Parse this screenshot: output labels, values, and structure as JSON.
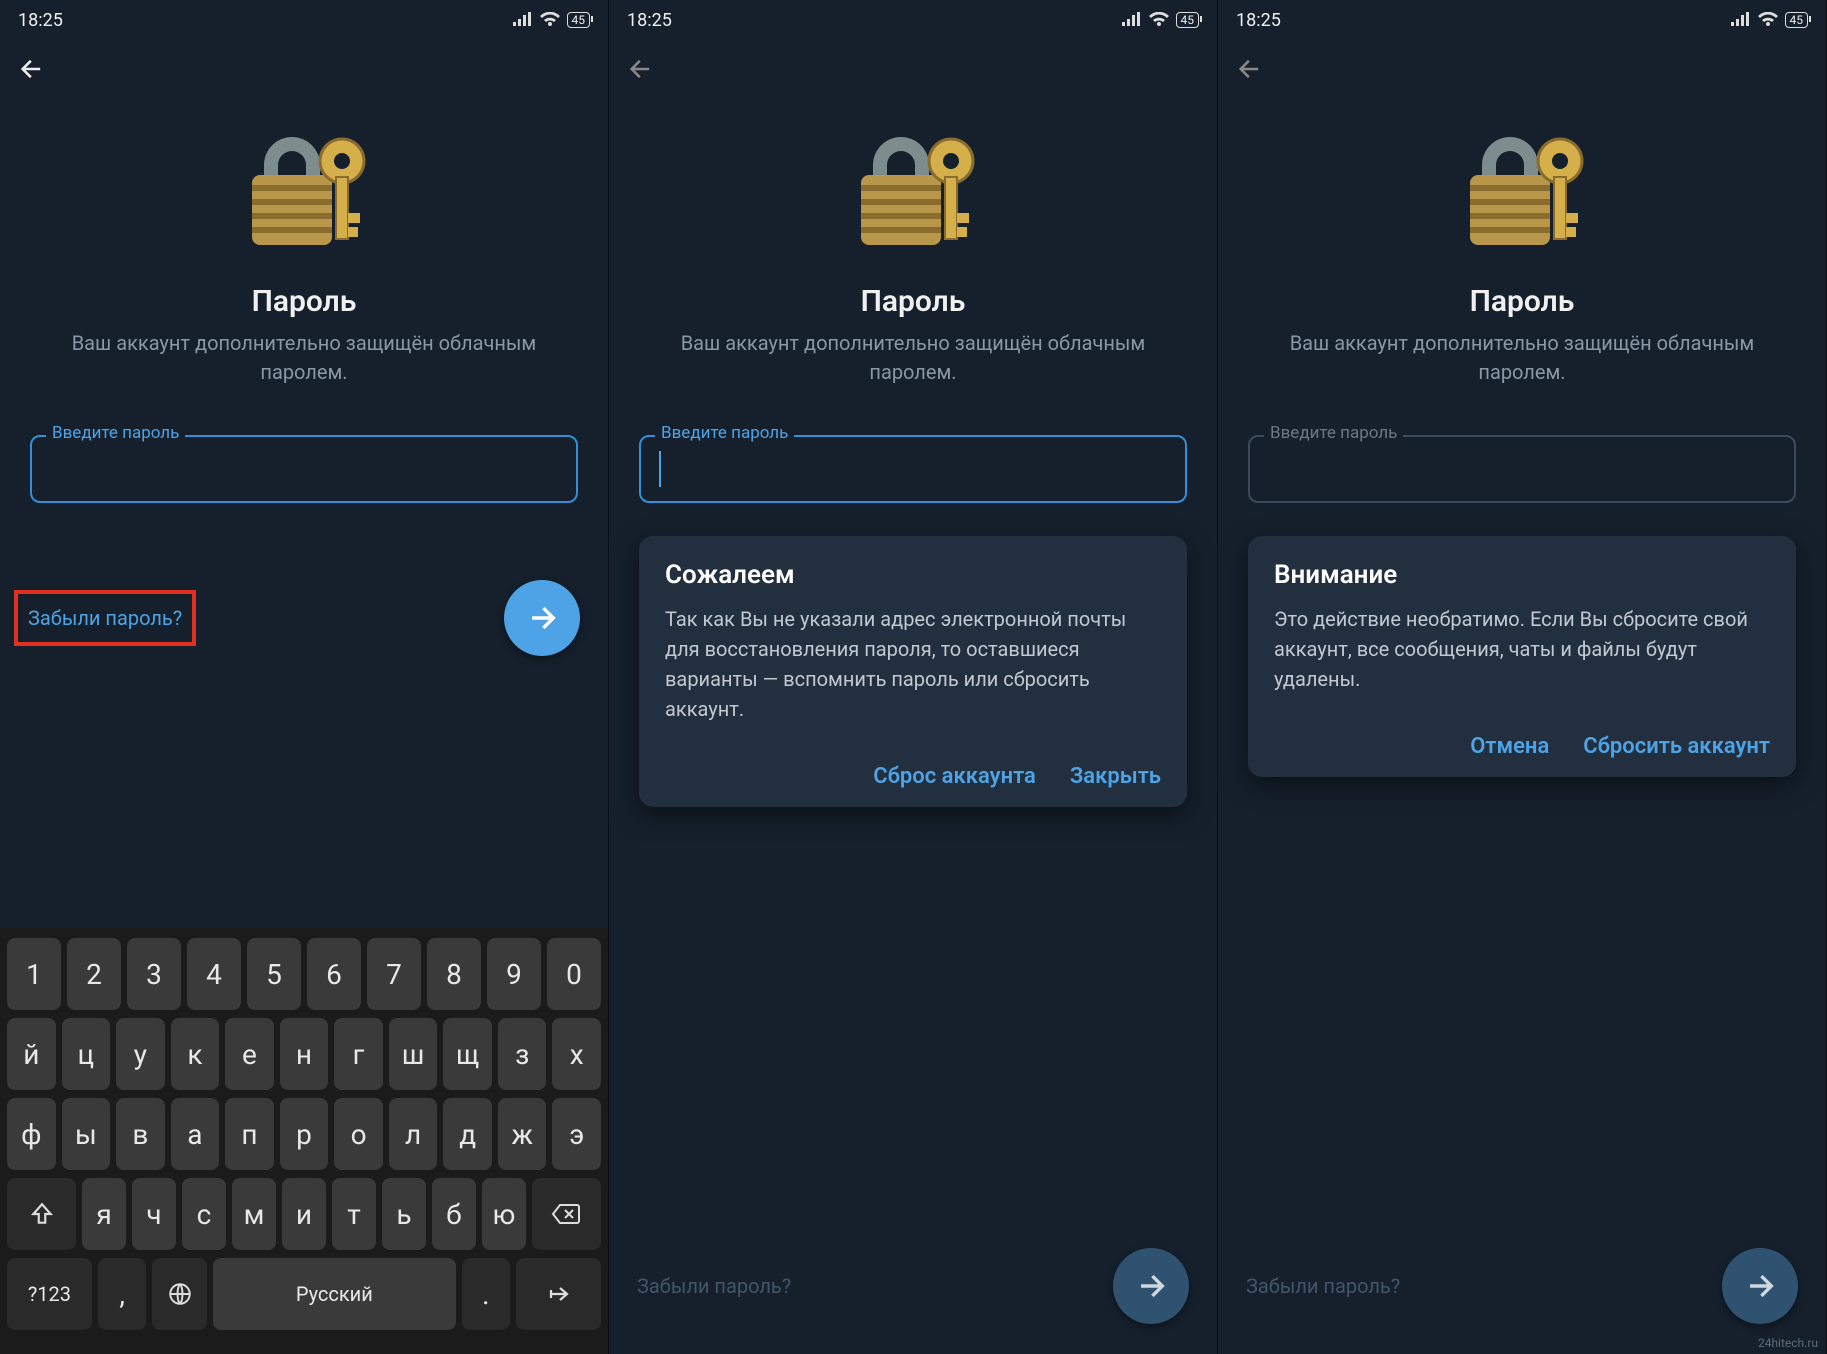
{
  "status": {
    "time": "18:25",
    "battery": "45"
  },
  "common": {
    "title": "Пароль",
    "subtitle": "Ваш аккаунт дополнительно защищён облачным паролем.",
    "input_label": "Введите пароль",
    "forgot": "Забыли пароль?"
  },
  "dialog_sorry": {
    "title": "Сожалеем",
    "body": "Так как Вы не указали адрес электронной почты для восстановления пароля, то оставшиеся варианты — вспомнить пароль или сбросить аккаунт.",
    "action_reset": "Сброс аккаунта",
    "action_close": "Закрыть"
  },
  "dialog_warn": {
    "title": "Внимание",
    "body": "Это действие необратимо. Если Вы сбросите свой аккаунт, все сообщения, чаты и файлы будут удалены.",
    "action_cancel": "Отмена",
    "action_reset": "Сбросить аккаунт"
  },
  "keyboard": {
    "row1": [
      "1",
      "2",
      "3",
      "4",
      "5",
      "6",
      "7",
      "8",
      "9",
      "0"
    ],
    "row2": [
      "й",
      "ц",
      "у",
      "к",
      "е",
      "н",
      "г",
      "ш",
      "щ",
      "з",
      "х"
    ],
    "row3": [
      "ф",
      "ы",
      "в",
      "а",
      "п",
      "р",
      "о",
      "л",
      "д",
      "ж",
      "э"
    ],
    "row4": [
      "я",
      "ч",
      "с",
      "м",
      "и",
      "т",
      "ь",
      "б",
      "ю"
    ],
    "symbols": "?123",
    "lang": "Русский"
  },
  "watermark": "24hitech.ru"
}
